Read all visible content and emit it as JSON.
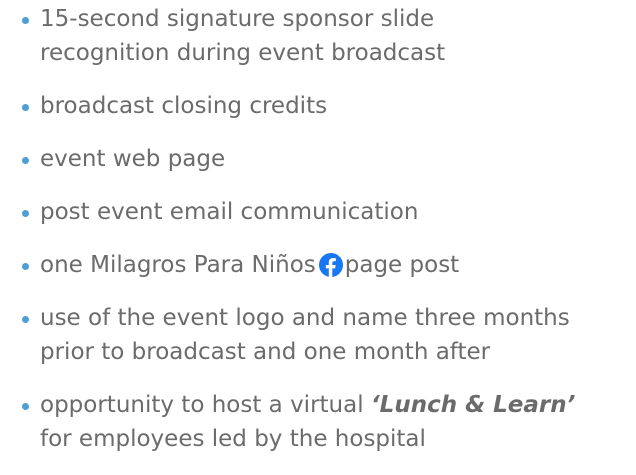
{
  "colors": {
    "text": "#6b6b6b",
    "bullet": "#4d9fd3",
    "facebook": "#1877f2"
  },
  "items": [
    {
      "line1": "15-second signature sponsor slide",
      "line2": "recognition during event broadcast"
    },
    {
      "line1": "broadcast closing credits"
    },
    {
      "line1": "event web page"
    },
    {
      "line1": "post event email communication"
    },
    {
      "before": "one Milagros Para Niños",
      "icon": "facebook-icon",
      "after": "page post"
    },
    {
      "line1": "use of the event logo and name three months",
      "line2": "prior to broadcast and one month after"
    },
    {
      "before": "opportunity to host a virtual ",
      "emph": "‘Lunch & Learn’",
      "line2": "for employees led by the hospital"
    }
  ]
}
